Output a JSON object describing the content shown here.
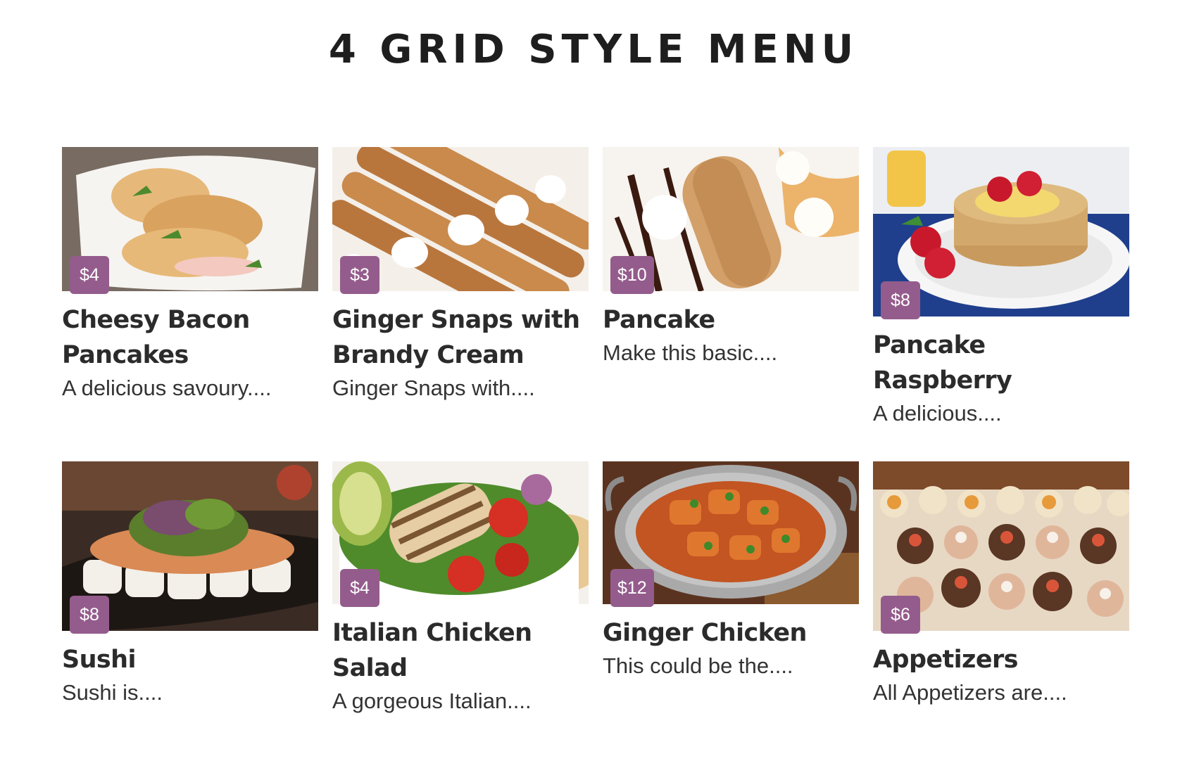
{
  "page_title": "4 GRID STYLE MENU",
  "accent_color": "#945c8c",
  "items": [
    {
      "title": "Cheesy Bacon Pancakes",
      "price": "$4",
      "description": "A delicious savoury....",
      "image": "cheesy-bacon-pancakes-image"
    },
    {
      "title": "Ginger Snaps with Brandy Cream",
      "price": "$3",
      "description": "Ginger Snaps with....",
      "image": "ginger-snaps-image"
    },
    {
      "title": "Pancake",
      "price": "$10",
      "description": "Make this basic....",
      "image": "pancake-image"
    },
    {
      "title": "Pancake Raspberry",
      "price": "$8",
      "description": "A delicious....",
      "image": "pancake-raspberry-image"
    },
    {
      "title": "Sushi",
      "price": "$8",
      "description": "Sushi is....",
      "image": "sushi-image"
    },
    {
      "title": "Italian Chicken Salad",
      "price": "$4",
      "description": "A gorgeous Italian....",
      "image": "italian-chicken-salad-image"
    },
    {
      "title": "Ginger Chicken",
      "price": "$12",
      "description": "This could be the....",
      "image": "ginger-chicken-image"
    },
    {
      "title": "Appetizers",
      "price": "$6",
      "description": "All Appetizers are....",
      "image": "appetizers-image"
    }
  ]
}
